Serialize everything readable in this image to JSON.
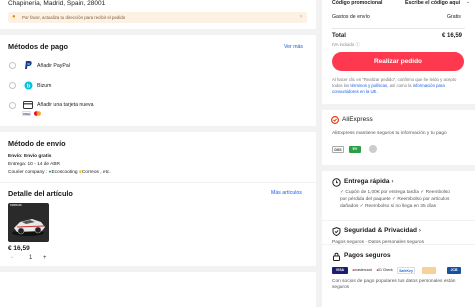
{
  "address": {
    "text": "Chapinería, Madrid, Spain, 28001",
    "warning": "Por favor, actualiza tu dirección para recibir el pedido",
    "warning_close": "›"
  },
  "payment": {
    "title": "Métodos de pago",
    "see_more": "Ver más",
    "methods": [
      {
        "label": "Añadir PayPal",
        "icon": "paypal-icon"
      },
      {
        "label": "Bizum",
        "icon": "bizum-icon"
      },
      {
        "label": "Añadir una tarjeta nueva",
        "icon": "card-icon"
      }
    ],
    "card_brands": [
      "VISA",
      "mastercard"
    ]
  },
  "shipping": {
    "title": "Método de envío",
    "method": "Envío: Envío gratis",
    "delivery": "Entrega: 10 - 14 de ABR",
    "courier_prefix": "Courier company :",
    "courier_a": "Ecoscooting",
    "courier_b": "Correos",
    "courier_suffix": ", etc."
  },
  "items": {
    "title": "Detalle del artículo",
    "more": "Más artículos",
    "thumb_label": "FERRARI",
    "price": "€ 16,59",
    "qty": "1",
    "minus": "−",
    "plus": "+"
  },
  "summary": {
    "promo_label": "Código promocional",
    "promo_value": "Escribe el código aquí",
    "shipping_label": "Gastos de envío",
    "shipping_value": "Gratis",
    "total_label": "Total",
    "total_value": "€ 16,59",
    "vat_note": "IVA incluido",
    "place_order": "Realizar pedido",
    "terms_before": "Al hacer clic en \"Realizar pedido\", confirmo que he leído y acepto todos los ",
    "terms_link": "términos y políticas",
    "terms_mid": ", así como la ",
    "terms_link2": "información para consumidores en la UE",
    "terms_after": "."
  },
  "trust": {
    "brand": "AliExpress",
    "text": "AliExpress mantiene seguros tu información y tu pago",
    "badges": [
      "DSS",
      "EV SSL",
      "seal"
    ]
  },
  "delivery_fast": {
    "title": "Entrega rápida",
    "lines": [
      "✓ Cupón de 1,00€ por entrega tardía  ✓ Reembolso",
      "por pérdida del paquete  ✓ Reembolso por artículos",
      "dañados  ✓ Reembolso si no llega en 35 días"
    ]
  },
  "security": {
    "title": "Seguridad & Privacidad",
    "text": "Pagos seguros · Datos personales seguros"
  },
  "secure_payments": {
    "title": "Pagos seguros",
    "logos": [
      "VISA",
      "mastercard",
      "ID Check",
      "SafeKey",
      "JCB"
    ],
    "text": "Con socios de pago populares tus datos personales están seguros"
  },
  "colors": {
    "accent": "#fd384f",
    "link": "#1a5ce0",
    "check": "#c7392b"
  }
}
